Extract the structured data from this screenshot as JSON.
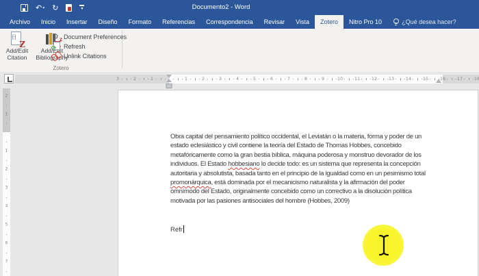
{
  "titlebar": {
    "title": "Documento2 - Word",
    "qat_icons": [
      "save-icon",
      "undo-icon",
      "redo-icon",
      "nitro-pdf-icon",
      "qat-customize-icon"
    ]
  },
  "tabs": [
    {
      "label": "Archivo",
      "name": "tab-archivo",
      "active": false
    },
    {
      "label": "Inicio",
      "name": "tab-inicio",
      "active": false
    },
    {
      "label": "Insertar",
      "name": "tab-insertar",
      "active": false
    },
    {
      "label": "Diseño",
      "name": "tab-diseno",
      "active": false
    },
    {
      "label": "Formato",
      "name": "tab-formato",
      "active": false
    },
    {
      "label": "Referencias",
      "name": "tab-referencias",
      "active": false
    },
    {
      "label": "Correspondencia",
      "name": "tab-correspondencia",
      "active": false
    },
    {
      "label": "Revisar",
      "name": "tab-revisar",
      "active": false
    },
    {
      "label": "Vista",
      "name": "tab-vista",
      "active": false
    },
    {
      "label": "Zotero",
      "name": "tab-zotero",
      "active": true
    },
    {
      "label": "Nitro Pro 10",
      "name": "tab-nitro-pro-10",
      "active": false
    }
  ],
  "help": {
    "label": "¿Qué desea hacer?",
    "icon": "lightbulb-icon"
  },
  "ribbon": {
    "group_label": "Zotero",
    "big_buttons": [
      {
        "label_line1": "Add/Edit",
        "label_line2": "Citation",
        "icon": "citation-document-icon"
      },
      {
        "label_line1": "Add/Edit",
        "label_line2": "Bibliography",
        "icon": "bibliography-books-icon"
      }
    ],
    "small_buttons": [
      {
        "label": "Document Preferences",
        "icon": "gear-icon"
      },
      {
        "label": "Refresh",
        "icon": "refresh-icon"
      },
      {
        "label": "Unlink Citations",
        "icon": "unlink-icon"
      }
    ]
  },
  "ruler": {
    "h_left_margin_numbers": [
      "3",
      "2",
      "1"
    ],
    "h_text_numbers": [
      "1",
      "2",
      "3",
      "4",
      "5",
      "6",
      "7",
      "8",
      "9",
      "10",
      "11",
      "12",
      "13",
      "14",
      "15"
    ],
    "h_right_margin_numbers": [
      "16",
      "17",
      "18"
    ],
    "v_top_margin_numbers": [
      "2",
      "1"
    ],
    "v_body_numbers": [
      "1",
      "2",
      "3",
      "4",
      "5",
      "6",
      "7"
    ]
  },
  "document": {
    "paragraph_lines": [
      "Obra capital del pensamiento político occidental, el Leviatán o la materia, forma y poder de un",
      "estado eclesiástico y civil contiene la teoría del Estado de Thomas Hobbes, concebido",
      "metafóricamente como la gran bestia bíblica, máquina poderosa y monstruo devorador de los",
      "individuos. El Estado hobbesiano lo decide todo: es un sistema que representa la concepción",
      "autoritaria y absolutista, basada tanto en el principio de la igualdad como en un pesimismo total",
      "promonárquica, está dominada por el mecanicismo naturalista y la afirmación del poder",
      "omnímodo del Estado, originalmente concebido como un correctivo a la disolución política",
      "motivada por las pasiones antisociales del hombre (Hobbes, 2009)"
    ],
    "misspelled_words": [
      "hobbesiano",
      "promonárquica"
    ],
    "typed_text": "Refr"
  },
  "colors": {
    "titlebar_blue": "#2b579a",
    "zotero_red": "#b3322b",
    "squiggle_red": "#e0443a",
    "highlight_yellow": "#f8f42c"
  }
}
